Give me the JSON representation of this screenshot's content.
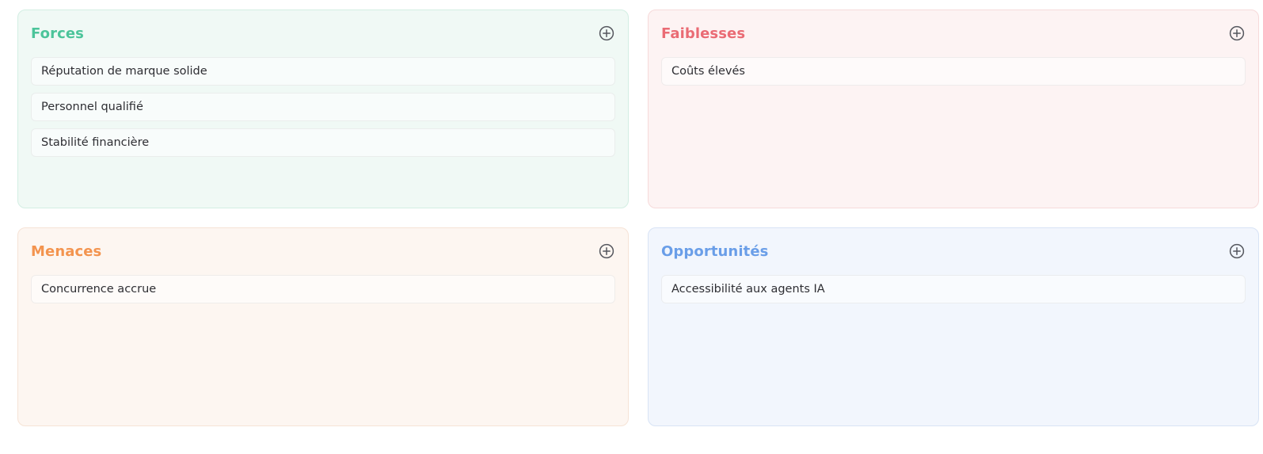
{
  "quadrants": [
    {
      "key": "forces",
      "title": "Forces",
      "color": "#4cc49a",
      "bg": "#f0f9f5",
      "border": "#d3eee3",
      "add_icon": "plus-circle-icon",
      "items": [
        "Réputation de marque solide",
        "Personnel qualifié",
        "Stabilité financière"
      ]
    },
    {
      "key": "faiblesses",
      "title": "Faiblesses",
      "color": "#ea6b74",
      "bg": "#fdf3f3",
      "border": "#f6dada",
      "add_icon": "plus-circle-icon",
      "items": [
        "Coûts élevés"
      ]
    },
    {
      "key": "menaces",
      "title": "Menaces",
      "color": "#f3944f",
      "bg": "#fdf6f1",
      "border": "#f6e3d6",
      "add_icon": "plus-circle-icon",
      "items": [
        "Concurrence accrue"
      ]
    },
    {
      "key": "opportunites",
      "title": "Opportunités",
      "color": "#6a9ee8",
      "bg": "#f2f6fd",
      "border": "#d8e3f5",
      "add_icon": "plus-circle-icon",
      "items": [
        "Accessibilité aux agents IA"
      ]
    }
  ]
}
